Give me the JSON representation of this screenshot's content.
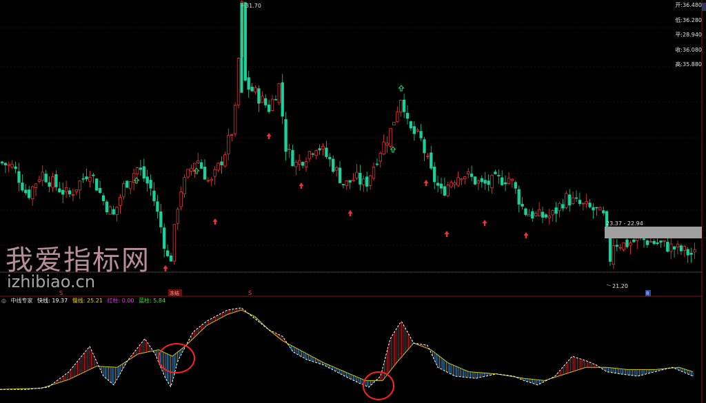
{
  "watermark": {
    "cn": "我爱指标网",
    "url": "izhibiao.cn"
  },
  "price_panel": {
    "right_labels": [
      {
        "label": "开:36.480"
      },
      {
        "label": "低:36.280"
      },
      {
        "label": "平:28.940"
      },
      {
        "label": "收:36.080"
      },
      {
        "label": "高:35.880"
      }
    ],
    "peak_label": "31.70",
    "range_label": "23.37 - 22.94",
    "low_label": "21.20",
    "bottom_markers": [
      "S",
      "冻结",
      "S",
      "8"
    ]
  },
  "indicator": {
    "name": "中线专家",
    "fast_label": "快线: 19.37",
    "slow_label": "慢线: 25.21",
    "red_label": "红柱: 0.00",
    "blue_label": "蓝柱: 5.84"
  },
  "colors": {
    "up": "#ff3b3b",
    "down": "#19d19a",
    "fast_line": "#ffffff",
    "slow_line": "#d4c800",
    "red_bar": "#c0202a",
    "blue_bar": "#3aa6d8",
    "circle": "#ff2020",
    "grid": "#5a1010"
  },
  "chart_data": {
    "type": "candlestick",
    "title": "",
    "peak": 31.7,
    "low": 21.2,
    "range_box": [
      22.94,
      23.37
    ],
    "grid": true
  }
}
